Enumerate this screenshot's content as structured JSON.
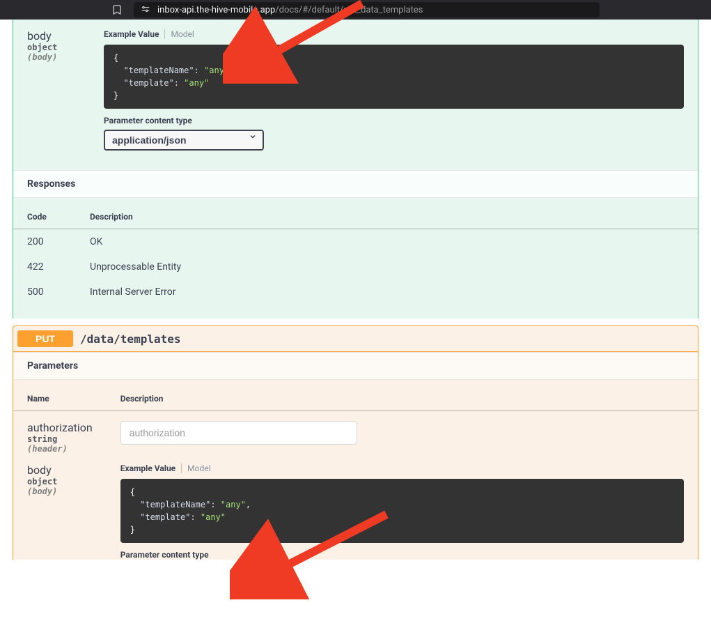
{
  "browser": {
    "url_host": "inbox-api.the-hive-mobile.app",
    "url_path": "/docs/#/default/put_data_templates"
  },
  "top_block": {
    "param_body": {
      "name": "body",
      "type": "object",
      "in": "(body)"
    },
    "model_tabs": {
      "example": "Example Value",
      "model": "Model"
    },
    "example_json": {
      "key1": "\"templateName\"",
      "val1": "\"any\"",
      "key2": "\"template\"",
      "val2": "\"any\""
    },
    "content_type_label": "Parameter content type",
    "content_type_value": "application/json",
    "responses_heading": "Responses",
    "responses_headers": {
      "code": "Code",
      "desc": "Description"
    },
    "responses": [
      {
        "code": "200",
        "desc": "OK"
      },
      {
        "code": "422",
        "desc": "Unprocessable Entity"
      },
      {
        "code": "500",
        "desc": "Internal Server Error"
      }
    ]
  },
  "put_block": {
    "method": "PUT",
    "path": "/data/templates",
    "parameters_heading": "Parameters",
    "params_headers": {
      "name": "Name",
      "desc": "Description"
    },
    "param_auth": {
      "name": "authorization",
      "type": "string",
      "in": "(header)",
      "placeholder": "authorization"
    },
    "param_body": {
      "name": "body",
      "type": "object",
      "in": "(body)"
    },
    "model_tabs": {
      "example": "Example Value",
      "model": "Model"
    },
    "example_json": {
      "key1": "\"templateName\"",
      "val1": "\"any\"",
      "key2": "\"template\"",
      "val2": "\"any\""
    },
    "content_type_label": "Parameter content type"
  }
}
